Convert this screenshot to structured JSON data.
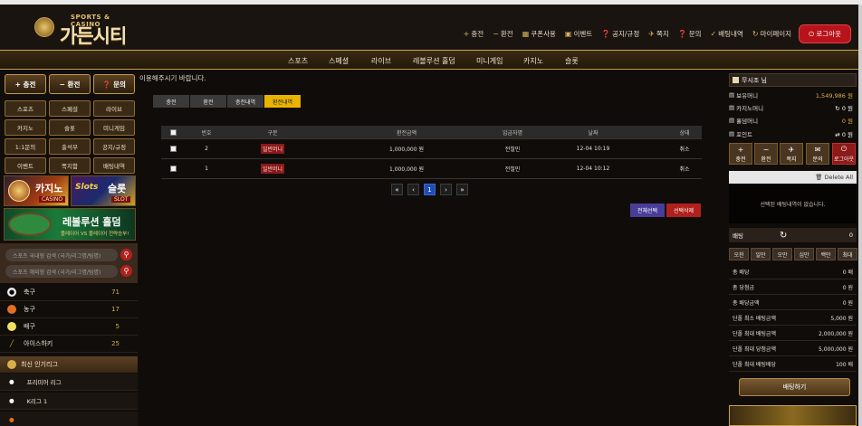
{
  "header": {
    "logo_sub": "SPORTS & CASINO",
    "logo_main": "가든시티",
    "links": [
      {
        "icon": "+",
        "label": "충전"
      },
      {
        "icon": "−",
        "label": "환전"
      },
      {
        "icon": "▦",
        "label": "쿠폰사용"
      },
      {
        "icon": "▣",
        "label": "이벤트"
      },
      {
        "icon": "❓",
        "label": "공지/규정"
      },
      {
        "icon": "✈",
        "label": "쪽지"
      },
      {
        "icon": "❓",
        "label": "문의"
      },
      {
        "icon": "✓",
        "label": "배팅내역"
      },
      {
        "icon": "↻",
        "label": "마이페이지"
      }
    ],
    "logout": "로그아웃"
  },
  "nav": [
    "스포츠",
    "스페셜",
    "라이브",
    "레볼루션 홀덤",
    "미니게임",
    "카지노",
    "슬롯"
  ],
  "left": {
    "quick": [
      {
        "icon": "+",
        "label": "충전"
      },
      {
        "icon": "−",
        "label": "환전"
      },
      {
        "icon": "❓",
        "label": "문의"
      }
    ],
    "grid": [
      "스포츠",
      "스페셜",
      "라이브",
      "카지노",
      "슬롯",
      "미니게임",
      "1:1문의",
      "출석부",
      "공지/규정",
      "이벤트",
      "쪽지함",
      "배팅내역"
    ],
    "banner_casino": "카지노",
    "banner_casino_sub": "CASINO",
    "banner_slot": "슬롯",
    "banner_slot_sub": "SLOT",
    "banner_slot_logo": "Slots",
    "banner_holdem": "레볼루션 홀덤",
    "banner_holdem_sub": "플레이어 VS 플레이어 전략승부!",
    "search1": "스포츠 국내형 검색 (국가/리그명/팀명)",
    "search2": "스포츠 해외형 검색 (국가/리그명/팀명)",
    "sports": [
      {
        "name": "축구",
        "count": "71"
      },
      {
        "name": "농구",
        "count": "17"
      },
      {
        "name": "배구",
        "count": "5"
      },
      {
        "name": "아이스하키",
        "count": "25"
      }
    ],
    "league_title": "최신 인기리그",
    "leagues": [
      "프리미어 리그",
      "K리그 1"
    ]
  },
  "center": {
    "marquee": "이용해주시기 바랍니다.",
    "tabs": [
      "충전",
      "환전",
      "충전내역",
      "환전내역"
    ],
    "columns": [
      "번호",
      "구분",
      "환전금액",
      "입금자명",
      "날짜",
      "상태"
    ],
    "rows": [
      {
        "no": "2",
        "type": "일반머니",
        "amount": "1,000,000 원",
        "name": "전철민",
        "date": "12-04 10:19",
        "status": "취소"
      },
      {
        "no": "1",
        "type": "일반머니",
        "amount": "1,000,000 원",
        "name": "전철민",
        "date": "12-04 10:12",
        "status": "취소"
      }
    ],
    "pager": [
      "«",
      "‹",
      "1",
      "›",
      "»"
    ],
    "btn_all": "전체선택",
    "btn_del": "선택삭제"
  },
  "right": {
    "user": "무시조 님",
    "money_label": "보유머니",
    "money": "1,549,986 원",
    "casino_label": "카지노머니",
    "casino": "0 원",
    "holdem_label": "홀덤머니",
    "holdem": "0 원",
    "point_label": "포인트",
    "point": "0 원",
    "actions": [
      {
        "icon": "+",
        "label": "충전"
      },
      {
        "icon": "−",
        "label": "환전"
      },
      {
        "icon": "✈",
        "label": "쪽지"
      },
      {
        "icon": "✉",
        "label": "문의"
      },
      {
        "icon": "⏻",
        "label": "로그아웃"
      }
    ],
    "delete_all": "Delete All",
    "no_bets": "선택된 배팅내역이 없습니다.",
    "bet_label": "배팅",
    "bet_value": "0",
    "odds": [
      "오천",
      "일만",
      "오만",
      "십만",
      "백만",
      "최대"
    ],
    "stats": [
      {
        "label": "총 배당",
        "value": "0 배"
      },
      {
        "label": "총 당첨금",
        "value": "0 원"
      },
      {
        "label": "총 배당금액",
        "value": "0 원"
      },
      {
        "label": "단폴 최소 배팅금액",
        "value": "5,000 원"
      },
      {
        "label": "단폴 최대 배팅금액",
        "value": "2,000,000 원"
      },
      {
        "label": "단폴 최대 당첨금액",
        "value": "5,000,000 원"
      },
      {
        "label": "단폴 최대 배팅배당",
        "value": "100 배"
      }
    ],
    "bet_button": "배팅하기"
  },
  "colors": {
    "gold": "#e3b246",
    "accent_red": "#b8121a",
    "active_tab": "#e9b300"
  }
}
